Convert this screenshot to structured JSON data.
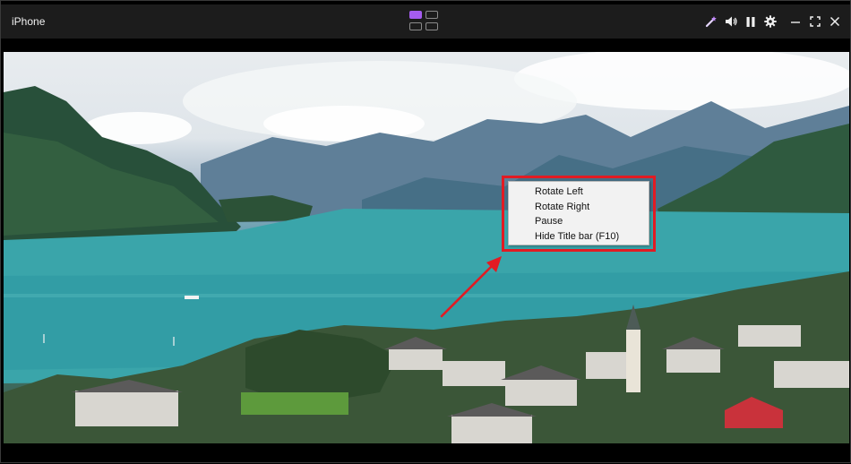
{
  "window": {
    "title": "iPhone"
  },
  "toolbar": {
    "icons": [
      "magic-wand-icon",
      "volume-icon",
      "pause-icon",
      "gear-icon",
      "minimize-icon",
      "fullscreen-icon",
      "close-icon"
    ],
    "layout_active_cell": 1,
    "accent_color": "#a55cf0"
  },
  "context_menu": {
    "items": [
      {
        "label": "Rotate Left"
      },
      {
        "label": "Rotate Right"
      },
      {
        "label": "Pause"
      },
      {
        "label": "Hide Title bar (F10)"
      }
    ]
  },
  "annotation": {
    "highlight_color": "#e21b23"
  }
}
